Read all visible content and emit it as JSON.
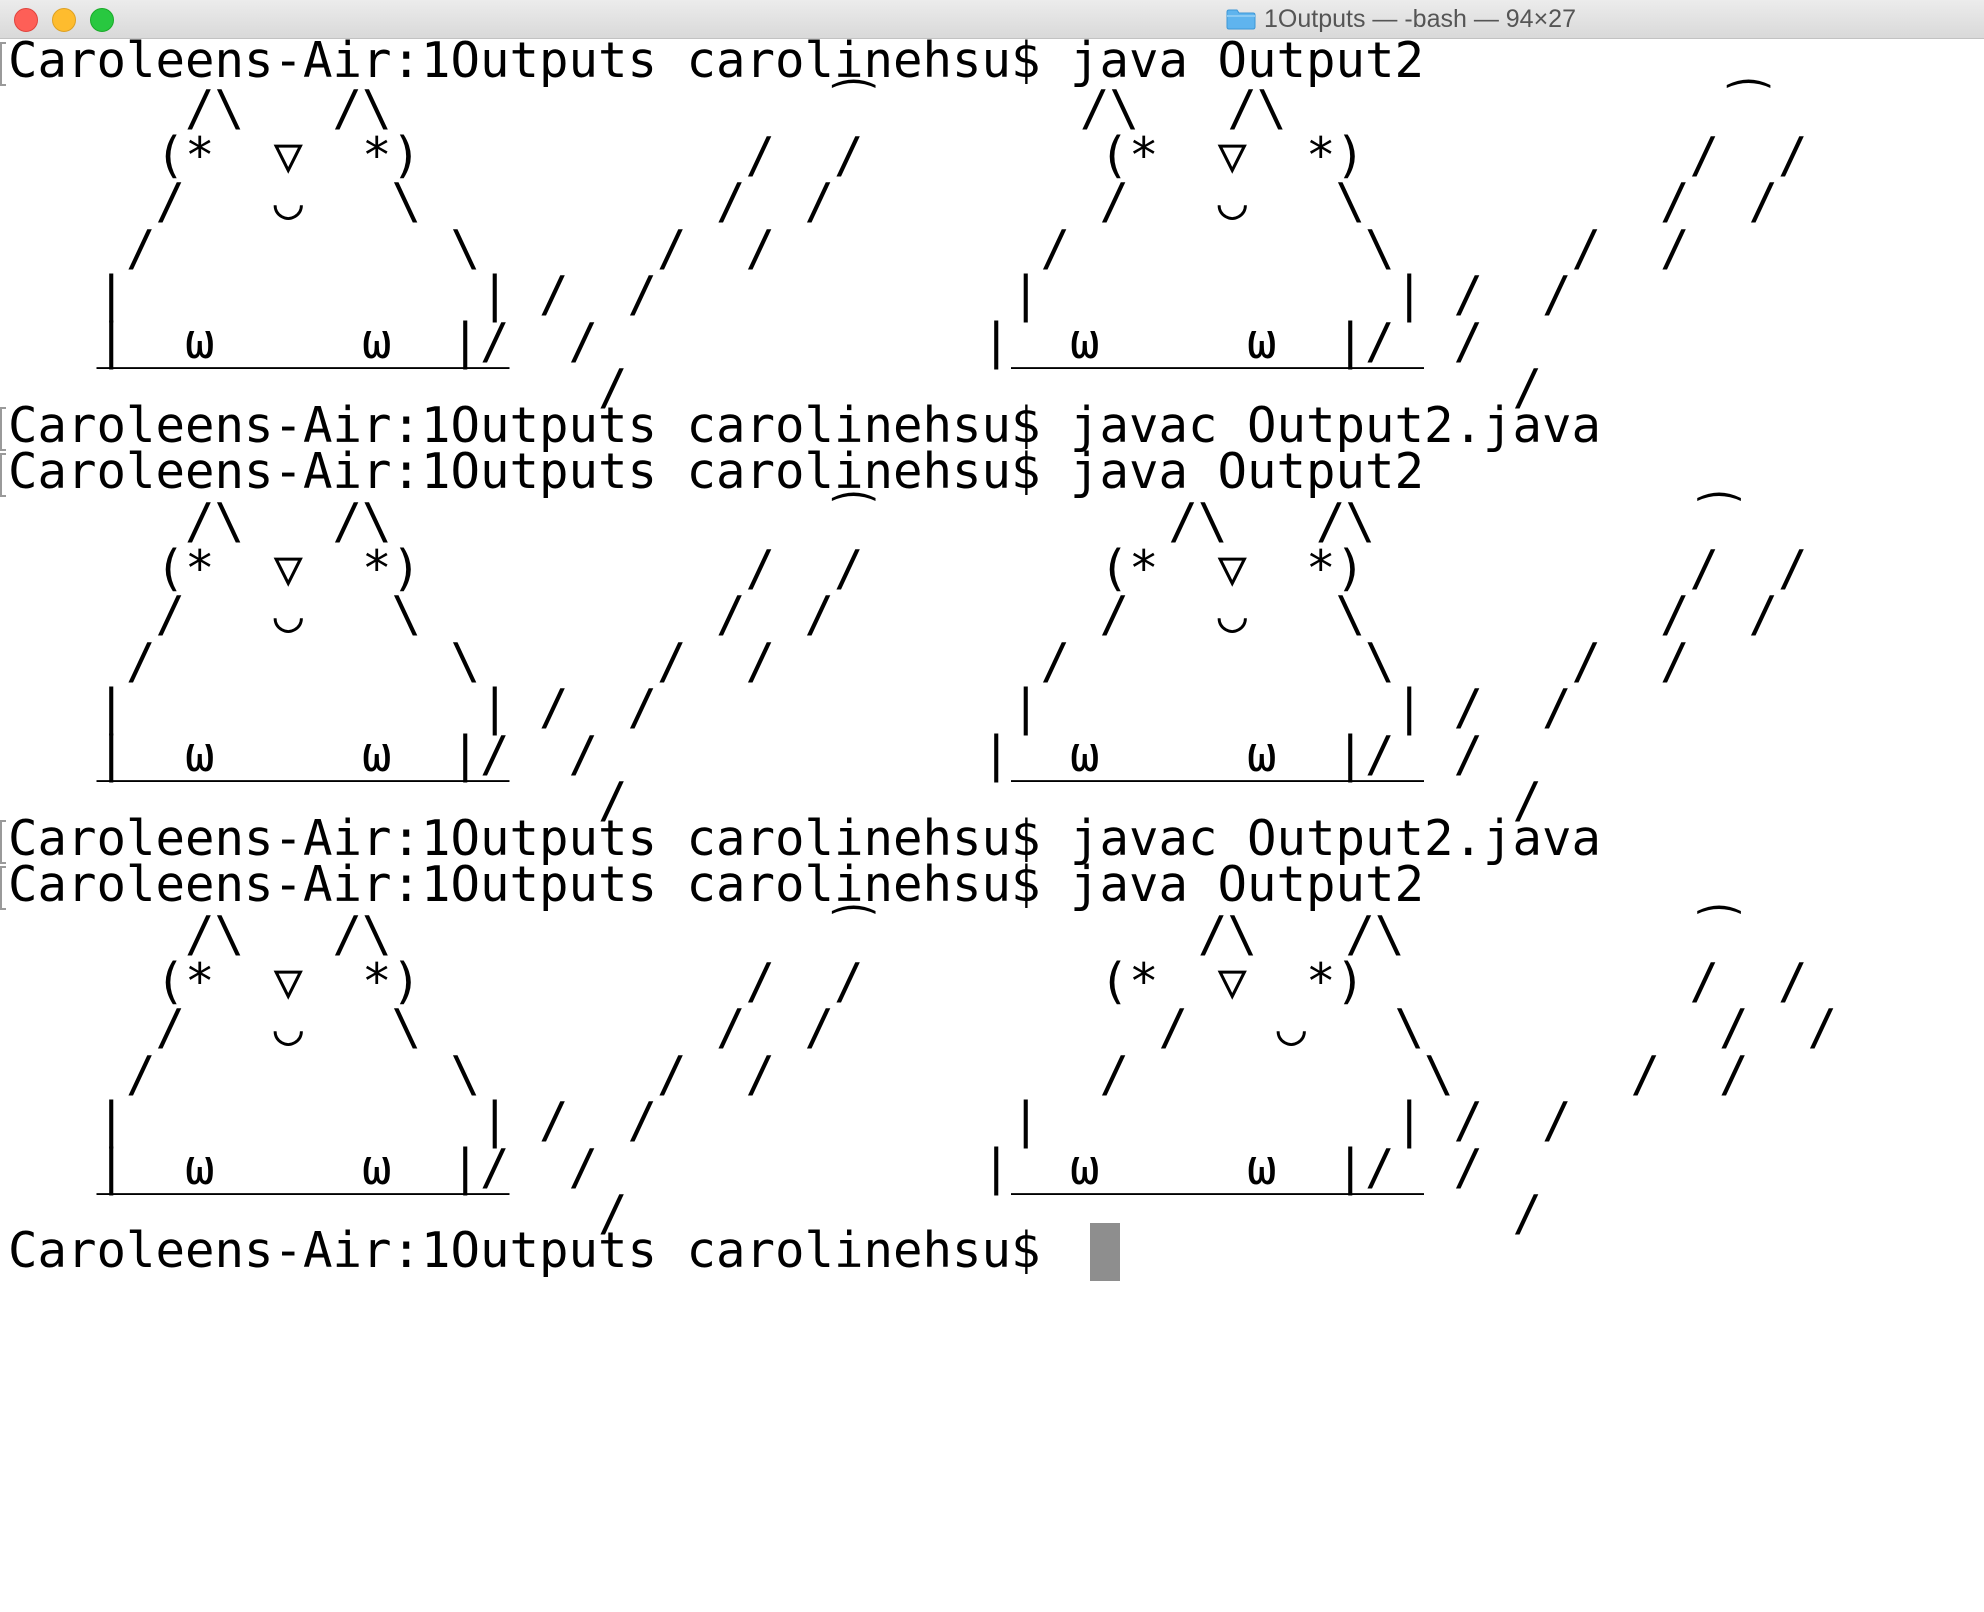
{
  "window": {
    "title": "1Outputs — -bash — 94×27",
    "folder_icon": "folder-icon",
    "colors": {
      "close": "#fe5f57",
      "minimize": "#febc2e",
      "zoom": "#28c840",
      "cursor": "#8e8e8e"
    }
  },
  "terminal": {
    "prompt": "Caroleens-Air:1Outputs carolinehsu$",
    "commands": [
      "java Output2",
      "javac Output2.java",
      "java Output2",
      "javac Output2.java",
      "java Output2",
      ""
    ],
    "outputs": [
      {
        "lines": [
          "      /\\   /\\               ⁀       /\\   /\\               ⁀",
          "     (*  ▽  *)           /  /        (*  ▽  *)           /  /",
          "     /   ◡   \\          /  /         /   ◡   \\          /  /",
          "    /          \\      /  /         /          \\      /  /",
          "   |            | /  /            |            | /  /",
          "   |  ω     ω  |/  /             |  ω     ω  |/  /",
          "   ‾‾‾‾‾‾‾‾‾‾‾‾‾‾   /             ‾‾‾‾‾‾‾‾‾‾‾‾‾‾   /"
        ]
      },
      {
        "lines": [
          "      /\\   /\\               ⁀          /\\   /\\           ⁀",
          "     (*  ▽  *)           /  /        (*  ▽  *)           /  /",
          "     /   ◡   \\          /  /         /   ◡   \\          /  /",
          "    /          \\      /  /         /          \\      /  /",
          "   |            | /  /            |            | /  /",
          "   |  ω     ω  |/  /             |  ω     ω  |/  /",
          "   ‾‾‾‾‾‾‾‾‾‾‾‾‾‾   /             ‾‾‾‾‾‾‾‾‾‾‾‾‾‾   /"
        ]
      },
      {
        "lines": [
          "      /\\   /\\               ⁀           /\\   /\\          ⁀",
          "     (*  ▽  *)           /  /        (*  ▽  *)           /  /",
          "     /   ◡   \\          /  /           /   ◡   \\          /  /",
          "    /          \\      /  /           /          \\      /  /",
          "   |            | /  /            |            | /  /",
          "   |  ω     ω  |/  /             |  ω     ω  |/  /",
          "   ‾‾‾‾‾‾‾‾‾‾‾‾‾‾   /             ‾‾‾‾‾‾‾‾‾‾‾‾‾‾   /"
        ]
      }
    ]
  }
}
